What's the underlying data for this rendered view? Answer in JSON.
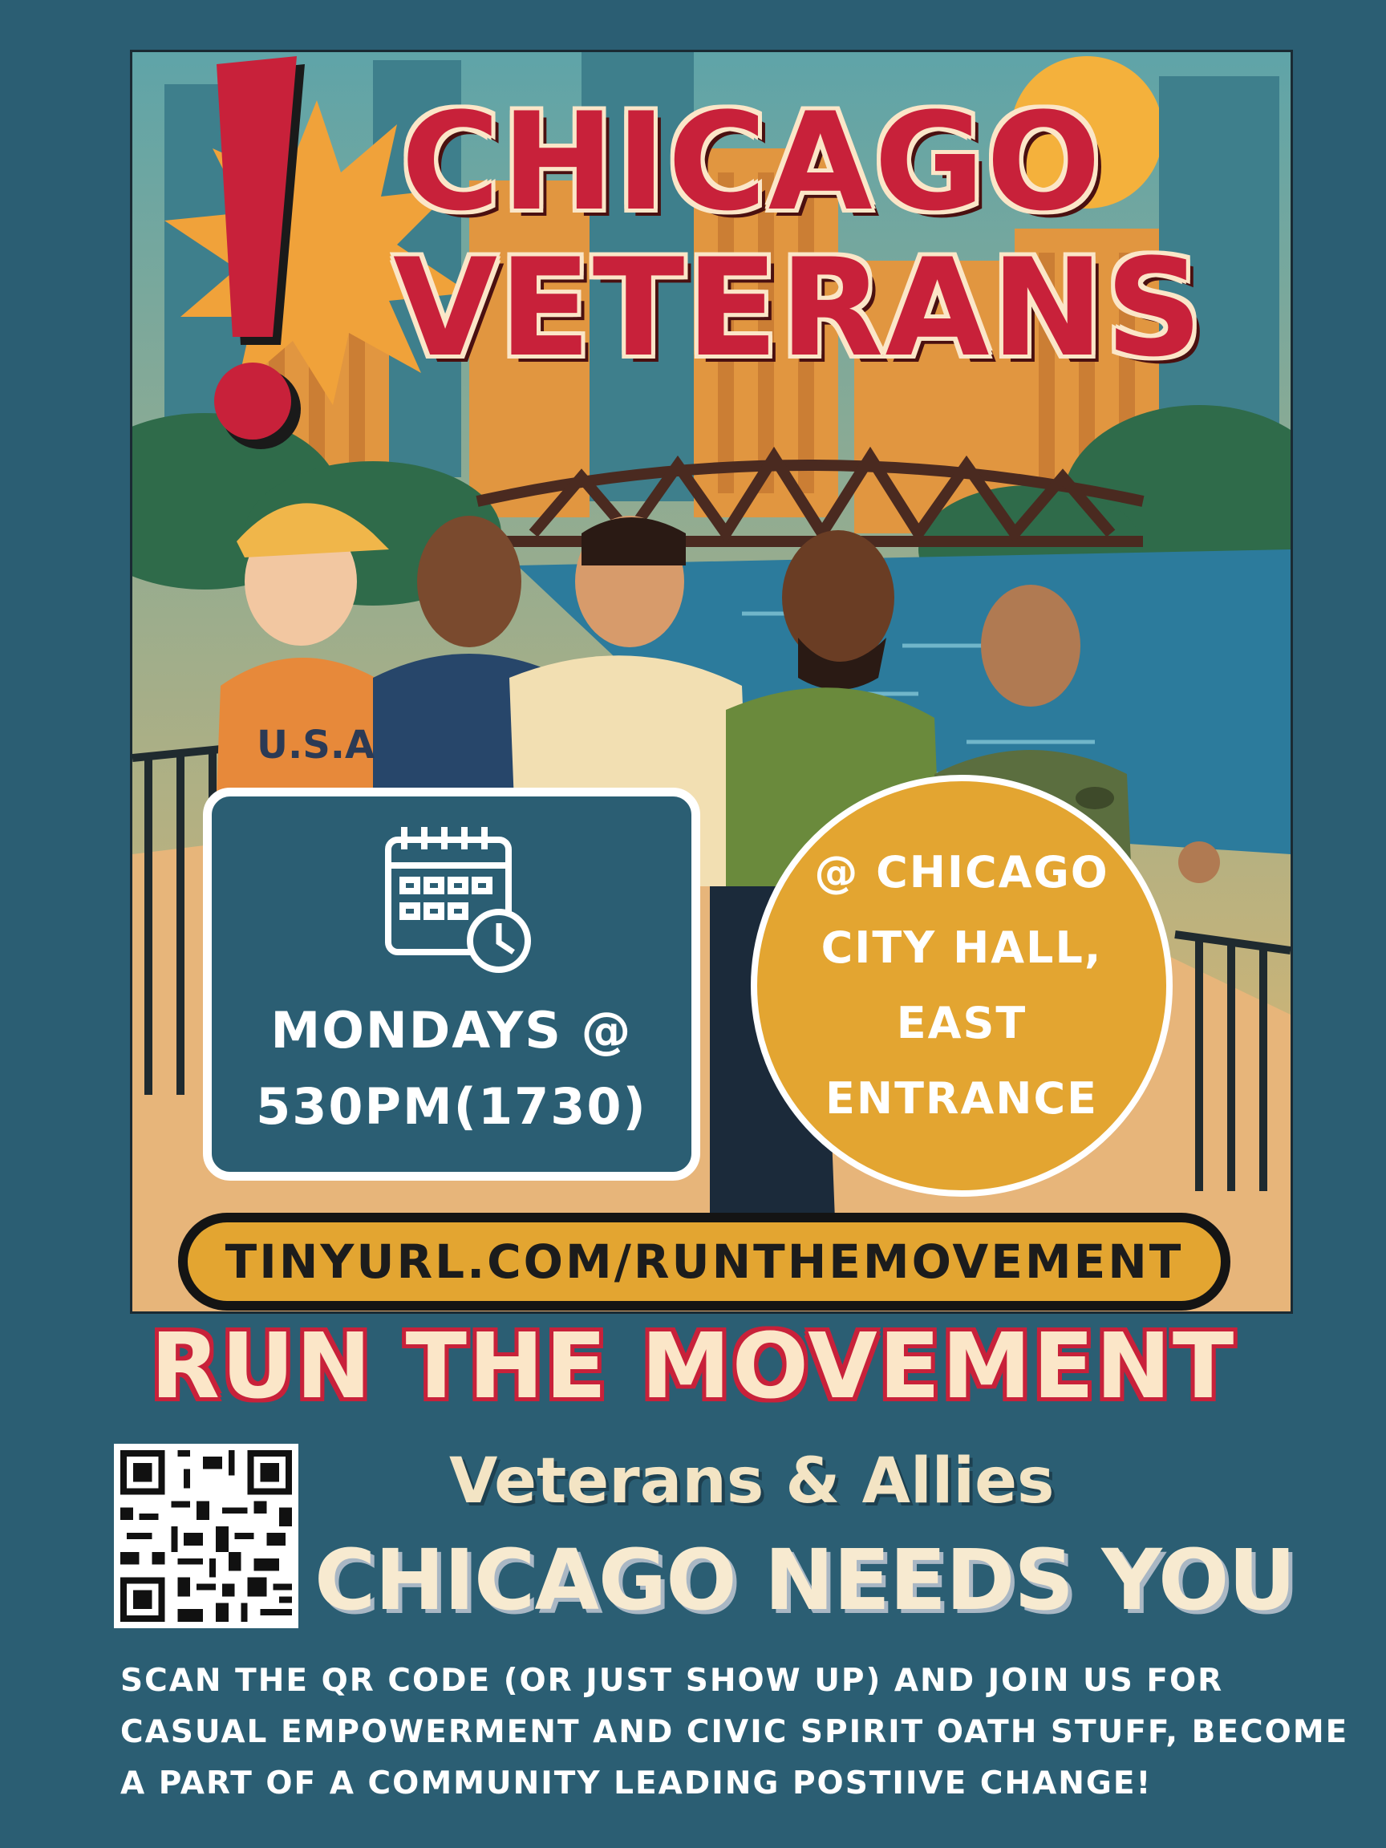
{
  "poster": {
    "headline_line1": "CHICAGO",
    "headline_line2": "VETERANS",
    "exclamation": "!",
    "shirt_text": "U.S.A",
    "schedule": {
      "icon": "calendar-clock-icon",
      "line1": "MONDAYS @",
      "line2": "530PM(1730)"
    },
    "location": {
      "lines": [
        "@ CHICAGO",
        "CITY HALL,",
        "EAST",
        "ENTRANCE"
      ]
    },
    "url": "TINYURL.COM/RUNTHEMOVEMENT",
    "title": "RUN THE MOVEMENT",
    "subtitle": "Veterans & Allies",
    "call_to_action": "CHICAGO NEEDS YOU",
    "body_lines": [
      "SCAN THE QR CODE (OR JUST SHOW UP) AND JOIN US FOR",
      "CASUAL EMPOWERMENT AND CIVIC SPIRIT OATH STUFF, BECOME",
      "A PART OF A COMMUNITY LEADING POSTIIVE CHANGE!"
    ],
    "colors": {
      "background": "#2b5e73",
      "accent_red": "#c8213a",
      "accent_gold": "#e3a531",
      "cream": "#fbe6c8"
    }
  }
}
